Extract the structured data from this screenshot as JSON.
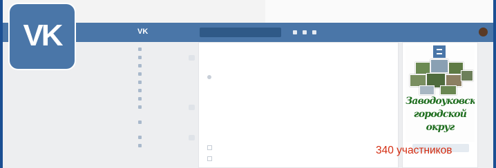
{
  "browser": {
    "tab_title": ""
  },
  "topbar": {
    "search_placeholder": "",
    "user_name": ""
  },
  "logo": {
    "big": "VK",
    "small": "VK"
  },
  "sidebar": {
    "items": [
      {
        "label": "",
        "badge": ""
      },
      {
        "label": "",
        "badge": ""
      },
      {
        "label": "",
        "badge": ""
      },
      {
        "label": "",
        "badge": ""
      },
      {
        "label": "",
        "badge": ""
      },
      {
        "label": "",
        "badge": ""
      },
      {
        "label": "",
        "badge": ""
      },
      {
        "label": "",
        "badge": ""
      },
      {
        "label": "",
        "badge": ""
      },
      {
        "label": "",
        "badge": ""
      },
      {
        "label": "",
        "badge": ""
      }
    ]
  },
  "post": {
    "header": "",
    "tabs": [
      "",
      ""
    ],
    "lines": [
      "",
      "",
      "",
      "",
      "",
      "",
      "",
      "",
      "",
      "",
      "",
      "",
      "",
      ""
    ],
    "links": [
      "",
      ""
    ]
  },
  "community": {
    "cover_title": "Заводоуковский городской округ",
    "members": "340 участников",
    "button": "",
    "row": ""
  },
  "colors": {
    "vk_blue": "#4a76a8",
    "frame_blue": "#1b4f93",
    "members_red": "#d42e12",
    "title_green": "#1e6d1e"
  },
  "icons": [
    "vk-logo-icon",
    "search-icon",
    "bell-icon",
    "music-icon",
    "menu-icon"
  ]
}
